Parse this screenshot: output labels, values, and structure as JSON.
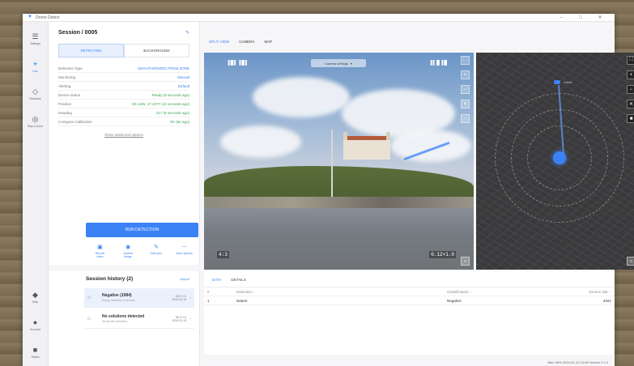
{
  "app": {
    "title": "Drone Detect"
  },
  "window_controls": [
    "–",
    "□",
    "✕"
  ],
  "rail": {
    "top": [
      {
        "icon": "menu-icon",
        "glyph": "☰",
        "label": "Settings"
      },
      {
        "icon": "crosshair-icon",
        "glyph": "⌖",
        "label": "Live",
        "active": true
      },
      {
        "icon": "sessions-icon",
        "glyph": "◇",
        "label": "Sessions"
      },
      {
        "icon": "map-icon",
        "glyph": "◎",
        "label": "Map & Zone"
      }
    ],
    "bottom": [
      {
        "icon": "help-icon",
        "glyph": "◆",
        "label": "Help"
      },
      {
        "icon": "account-icon",
        "glyph": "●",
        "label": "Account"
      },
      {
        "icon": "logout-icon",
        "glyph": "■",
        "label": "Status"
      }
    ]
  },
  "session": {
    "title": "Session / 0005",
    "edit_glyph": "✎",
    "tabs": [
      "DETECTION",
      "BACKGROUND"
    ],
    "params": [
      {
        "k": "Detection Type",
        "v": "UNAUTHORIZED FROM ZONE",
        "tone": "blue"
      },
      {
        "k": "Monitoring",
        "v": "Manual",
        "tone": "blue"
      },
      {
        "k": "Alerting",
        "v": "Default",
        "tone": "blue"
      },
      {
        "k": "Device status",
        "v": "Ready (8 seconds ago)",
        "tone": "green"
      },
      {
        "k": "Position",
        "v": "48.1486, 17.1077 (10 seconds ago)",
        "tone": "green"
      },
      {
        "k": "Heading",
        "v": "217 (8 seconds ago)",
        "tone": "green"
      },
      {
        "k": "Compass Calibration",
        "v": "OK (8s ago)",
        "tone": "green"
      }
    ],
    "show_advanced": "Show advanced options",
    "run_label": "RUN DETECTION",
    "actions": [
      {
        "icon": "record-icon",
        "glyph": "▣",
        "label": "Record\nvideo"
      },
      {
        "icon": "capture-icon",
        "glyph": "◉",
        "label": "Capture\nimage"
      },
      {
        "icon": "edit-zone-icon",
        "glyph": "✎",
        "label": "Edit zone"
      },
      {
        "icon": "more-icon",
        "glyph": "⋯",
        "label": "More options"
      }
    ]
  },
  "view_tabs": [
    "SPLIT VIEW",
    "CAMERA",
    "MAP"
  ],
  "camera": {
    "hud_left": "▐█▌▐█▌",
    "hud_right": "▐▌█▐█",
    "selector": "Camera settings",
    "selector_chevron": "▾",
    "bottom_left": "4:3",
    "bottom_right": "0.12×1.0",
    "tools": [
      "⛶",
      "+",
      "−",
      "✕",
      "◌"
    ],
    "bottom_tool": "⌂"
  },
  "map": {
    "waypoint_label": "Home",
    "tools": [
      "⛶",
      "+",
      "−",
      "✕",
      "■"
    ],
    "bottom_tool": "⌂"
  },
  "history": {
    "title": "Session history (2)",
    "export": "Export",
    "items": [
      {
        "name": "Negative (1984)",
        "sub": "Empty detection of drones",
        "time": "08:17:21",
        "date": "2024-01-10",
        "selected": true
      },
      {
        "name": "No solutions detected",
        "sub": "No drones detected",
        "time": "08:17:21",
        "date": "2024-01-10",
        "selected": false
      }
    ]
  },
  "detections": {
    "tabs": [
      "DATA",
      "DETAILS"
    ],
    "columns": [
      "#",
      "Detection ↑",
      "Classification ↑",
      "Drones dist. ↑"
    ],
    "rows": [
      {
        "n": "1",
        "det": "Nature",
        "cls": "Negative",
        "dist": "4021"
      }
    ]
  },
  "status_bar": "Batt: 98%   2024-01-10 13:48   Version 2.1.0"
}
